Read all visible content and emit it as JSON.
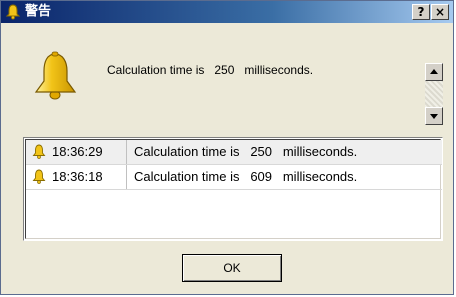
{
  "window": {
    "title": "警告",
    "help_label": "?",
    "close_label": "×"
  },
  "alert": {
    "message": "Calculation time is   250   milliseconds.",
    "icon": "bell-icon"
  },
  "log": {
    "rows": [
      {
        "time": "18:36:29",
        "message": "Calculation time is   250   milliseconds.",
        "icon": "bell-icon",
        "selected": true
      },
      {
        "time": "18:36:18",
        "message": "Calculation time is   609   milliseconds.",
        "icon": "bell-icon",
        "selected": false
      }
    ]
  },
  "buttons": {
    "ok_label": "OK"
  },
  "colors": {
    "bell": "#f2c418",
    "title_start": "#0a246a",
    "title_end": "#a6caf0",
    "dialog_bg": "#ece9d8"
  }
}
